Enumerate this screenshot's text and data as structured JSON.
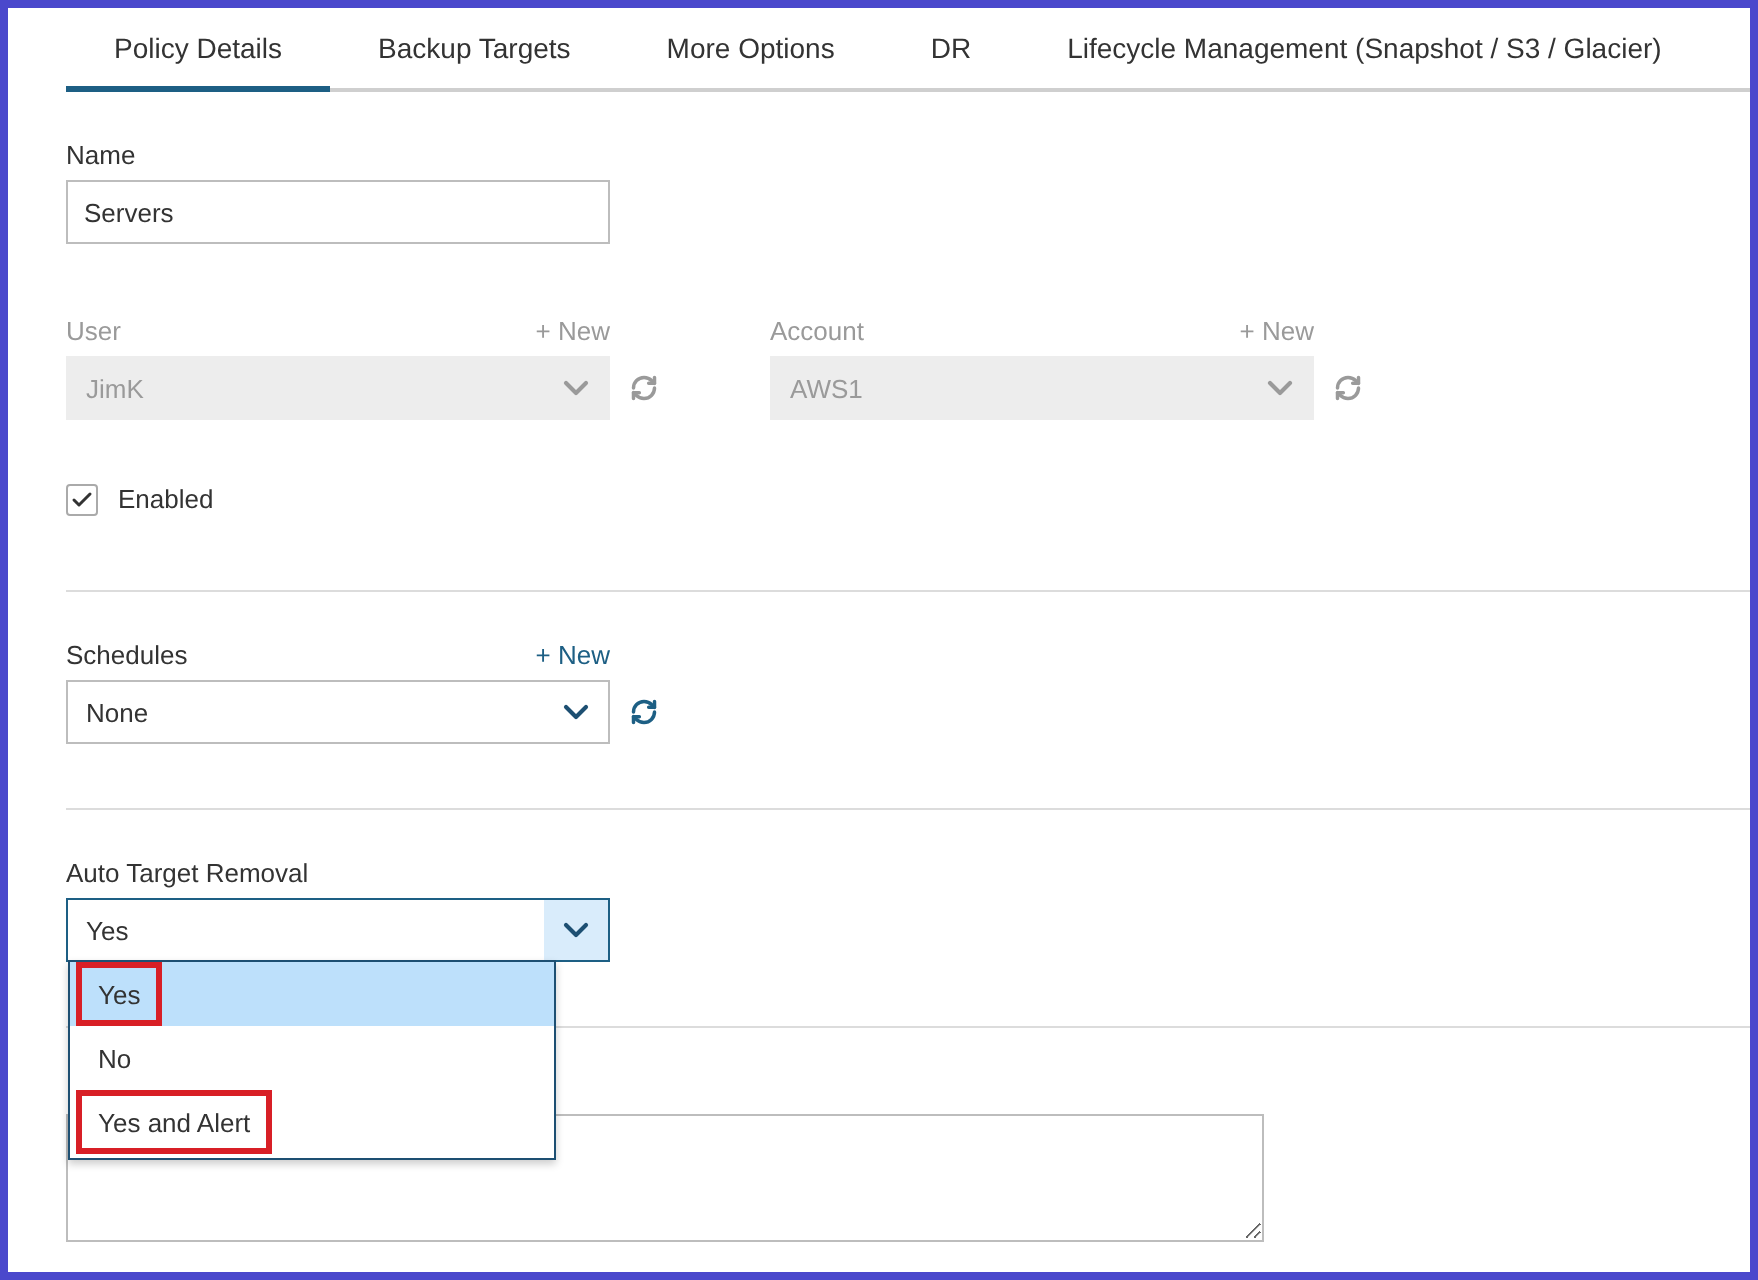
{
  "tabs": [
    {
      "label": "Policy Details",
      "selected": true
    },
    {
      "label": "Backup Targets",
      "selected": false
    },
    {
      "label": "More Options",
      "selected": false
    },
    {
      "label": "DR",
      "selected": false
    },
    {
      "label": "Lifecycle Management (Snapshot / S3 / Glacier)",
      "selected": false
    }
  ],
  "name": {
    "label": "Name",
    "value": "Servers"
  },
  "user": {
    "label": "User",
    "new_link": "+ New",
    "value": "JimK",
    "disabled": true
  },
  "account": {
    "label": "Account",
    "new_link": "+ New",
    "value": "AWS1",
    "disabled": true
  },
  "enabled": {
    "label": "Enabled",
    "checked": true
  },
  "schedules": {
    "label": "Schedules",
    "new_link": "+ New",
    "value": "None",
    "disabled": false
  },
  "auto_target_removal": {
    "label": "Auto Target Removal",
    "value": "Yes",
    "expanded": true,
    "options": [
      {
        "label": "Yes",
        "selected": true,
        "highlighted": true
      },
      {
        "label": "No",
        "selected": false,
        "highlighted": false
      },
      {
        "label": "Yes and Alert",
        "selected": false,
        "highlighted": true
      }
    ]
  }
}
